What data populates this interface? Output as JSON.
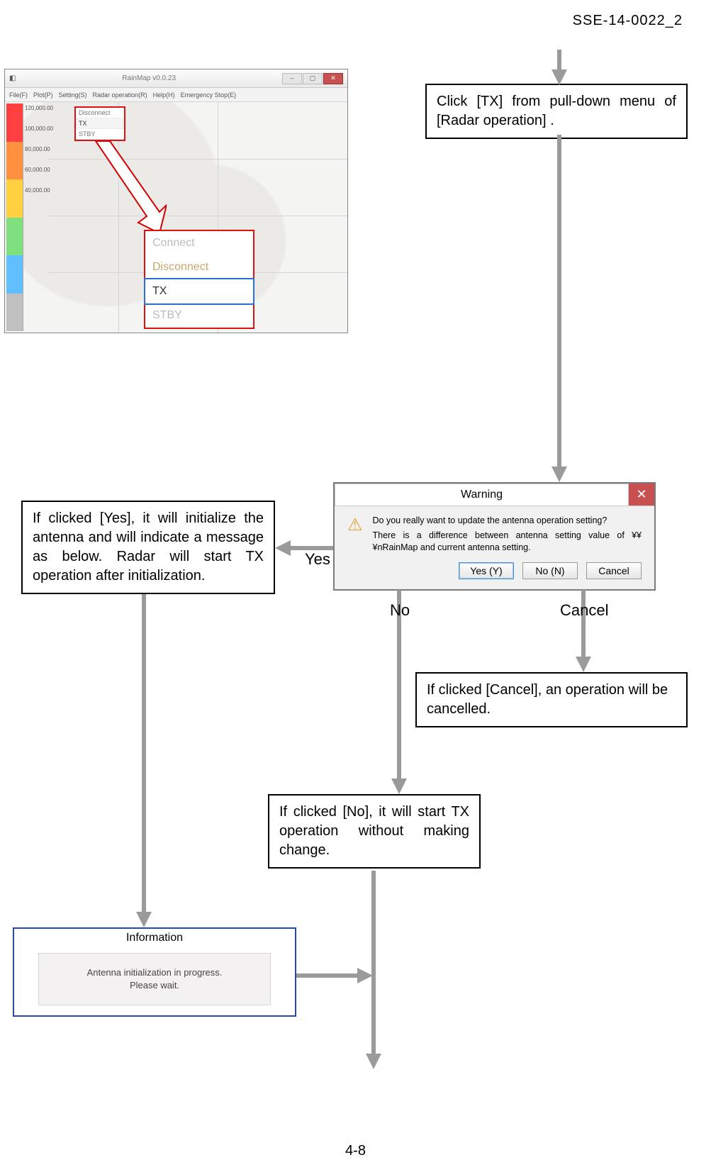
{
  "doc_id": "SSE-14-0022_2",
  "page_number": "4-8",
  "screenshot": {
    "app_title": "RainMap v0.0.23",
    "menu_items": [
      "File(F)",
      "Plot(P)",
      "Setting(S)",
      "Radar operation(R)",
      "Help(H)",
      "Emergency Stop(E)"
    ],
    "scale_values": [
      "120,000.00",
      "100,000.00",
      "80,000.00",
      "60,000.00",
      "40,000.00"
    ],
    "small_menu": {
      "disconnect": "Disconnect",
      "tx": "TX",
      "stby": "STBY"
    },
    "dropdown": {
      "connect": "Connect",
      "disconnect": "Disconnect",
      "tx": "TX",
      "stby": "STBY"
    }
  },
  "step1": "Click [TX] from pull-down menu of [Radar operation] .",
  "labels": {
    "yes": "Yes",
    "no": "No",
    "cancel": "Cancel"
  },
  "box_yes": "If clicked [Yes], it will initialize the antenna and will indicate a message as below. Radar will start TX operation after initialization.",
  "box_no": "If clicked [No], it will start TX operation without making change.",
  "box_cancel": "If clicked [Cancel], an operation will be cancelled.",
  "warning": {
    "title": "Warning",
    "question": "Do you really want to update the antenna operation setting?",
    "detail": "There is a difference between antenna setting value of ¥¥¥nRainMap and current antenna setting.",
    "yes": "Yes (Y)",
    "no": "No (N)",
    "cancel": "Cancel"
  },
  "information": {
    "title": "Information",
    "line1": "Antenna initialization in progress.",
    "line2": "Please wait."
  }
}
